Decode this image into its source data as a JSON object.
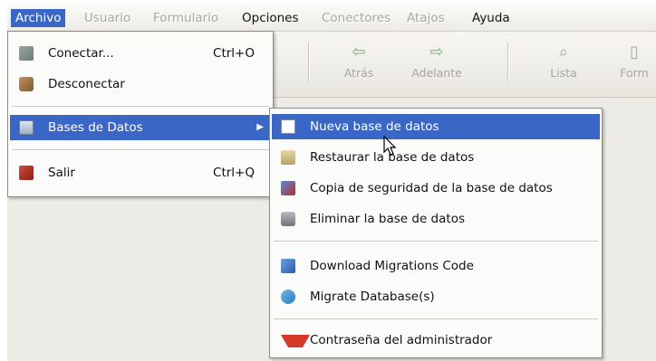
{
  "menubar": {
    "items": [
      {
        "label": "Archivo",
        "state": "active"
      },
      {
        "label": "Usuario",
        "state": "disabled"
      },
      {
        "label": "Formulario",
        "state": "disabled"
      },
      {
        "label": "Opciones",
        "state": "enabled"
      },
      {
        "label": "Conectores",
        "state": "disabled"
      },
      {
        "label": "Atajos",
        "state": "disabled"
      },
      {
        "label": "Ayuda",
        "state": "enabled"
      }
    ]
  },
  "toolbar": {
    "items": [
      {
        "label": "Atrás",
        "icon": "arrow-left-icon"
      },
      {
        "label": "Adelante",
        "icon": "arrow-right-icon"
      },
      {
        "label": "Lista",
        "icon": "magnifier-icon"
      },
      {
        "label": "Form",
        "icon": "form-icon"
      }
    ]
  },
  "archivo_menu": {
    "items": [
      {
        "label": "Conectar...",
        "shortcut": "Ctrl+O",
        "icon": "connect-icon"
      },
      {
        "label": "Desconectar",
        "shortcut": "",
        "icon": "disconnect-icon"
      },
      {
        "label": "Bases de Datos",
        "shortcut": "",
        "icon": "database-icon",
        "submenu": true,
        "highlighted": true
      },
      {
        "label": "Salir",
        "shortcut": "Ctrl+Q",
        "icon": "exit-icon"
      }
    ]
  },
  "bases_submenu": {
    "items": [
      {
        "label": "Nueva base de datos",
        "icon": "new-document-icon",
        "highlighted": true
      },
      {
        "label": "Restaurar la base de datos",
        "icon": "folder-icon"
      },
      {
        "label": "Copia de seguridad de la base de datos",
        "icon": "backup-icon"
      },
      {
        "label": "Eliminar la base de datos",
        "icon": "trash-icon"
      },
      {
        "label": "Download Migrations Code",
        "icon": "download-icon"
      },
      {
        "label": "Migrate Database(s)",
        "icon": "migrate-icon"
      },
      {
        "label": "Contraseña del administrador",
        "icon": "password-icon"
      }
    ]
  },
  "colors": {
    "highlight": "#3a67c5",
    "disabled_text": "#a7a6a0"
  }
}
